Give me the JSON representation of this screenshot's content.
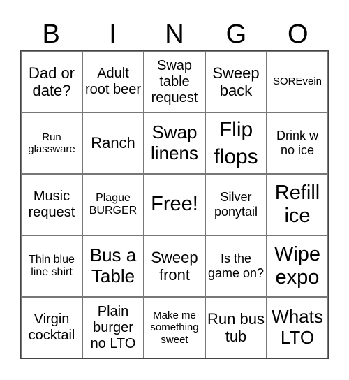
{
  "header": {
    "letters": [
      "B",
      "I",
      "N",
      "G",
      "O"
    ]
  },
  "cells": [
    "Dad or date?",
    "Adult root beer",
    "Swap table request",
    "Sweep back",
    "SOREvein",
    "Run glassware",
    "Ranch",
    "Swap linens",
    "Flip flops",
    "Drink w no ice",
    "Music request",
    "Plague BURGER",
    "Free!",
    "Silver ponytail",
    "Refill ice",
    "Thin blue line shirt",
    "Bus a Table",
    "Sweep front",
    "Is the game on?",
    "Wipe expo",
    "Virgin cocktail",
    "Plain burger no LTO",
    "Make me something sweet",
    "Run bus tub",
    "Whats LTO"
  ]
}
